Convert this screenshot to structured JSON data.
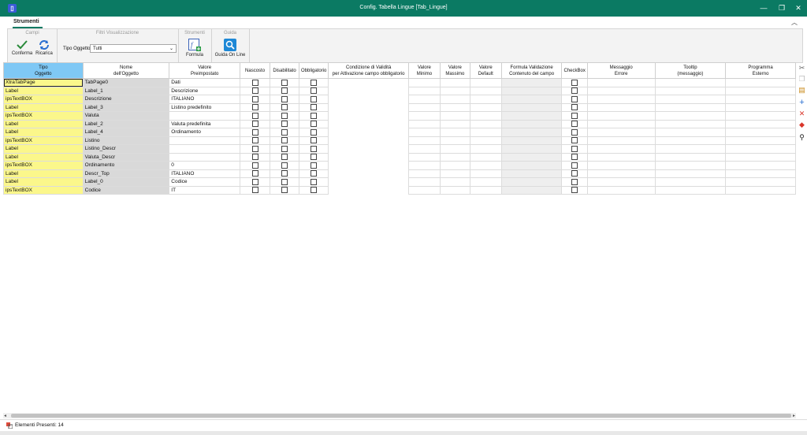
{
  "window": {
    "title": "Config. Tabella Lingue [Tab_Lingue]",
    "minimize": "—",
    "maximize": "❐",
    "close": "✕"
  },
  "ribbon": {
    "tab": "Strumenti",
    "groups": {
      "campi": {
        "title": "Campi",
        "confirm": "Conferma",
        "reload": "Ricarica"
      },
      "filtri": {
        "title": "Filtri Visualizzazione",
        "label": "Tipo Oggetto",
        "value": "Tutti"
      },
      "strumenti": {
        "title": "Strumenti",
        "formula": "Formula"
      },
      "guida": {
        "title": "Guida",
        "online": "Guida On Line"
      }
    }
  },
  "grid": {
    "columns": {
      "tipo": "Tipo\nOggetto",
      "nome": "Nome\ndell'Oggetto",
      "valore": "Valore\nPreimpostato",
      "nascosto": "Nascosto",
      "disabilitato": "Disabilitato",
      "obbligatorio": "Obbligatorio",
      "condizione": "Condizione di Validità\nper Attivazione campo obbligatorio",
      "min": "Valore\nMinimo",
      "max": "Valore\nMassimo",
      "default": "Valore\nDefault",
      "formula": "Formula Validazione\nContenuto del campo",
      "checkbox": "CheckBox",
      "messaggio": "Messaggio\nErrore",
      "tooltip": "Tooltip\n(messaggio)",
      "programma": "Programma\nEsterno"
    },
    "rows": [
      {
        "tipo": "XtraTabPage",
        "nome": "TabPage0",
        "valore": "Dati"
      },
      {
        "tipo": "Label",
        "nome": "Label_1",
        "valore": "Descrizione"
      },
      {
        "tipo": "ipsTextBOX",
        "nome": "Descrizione",
        "valore": "ITALIANO"
      },
      {
        "tipo": "Label",
        "nome": "Label_3",
        "valore": "Listino predefinito"
      },
      {
        "tipo": "ipsTextBOX",
        "nome": "Valuta",
        "valore": ""
      },
      {
        "tipo": "Label",
        "nome": "Label_2",
        "valore": "Valuta predefinita"
      },
      {
        "tipo": "Label",
        "nome": "Label_4",
        "valore": "Ordinamento"
      },
      {
        "tipo": "ipsTextBOX",
        "nome": "Listino",
        "valore": ""
      },
      {
        "tipo": "Label",
        "nome": "Listino_Descr",
        "valore": ""
      },
      {
        "tipo": "Label",
        "nome": "Valuta_Descr",
        "valore": ""
      },
      {
        "tipo": "ipsTextBOX",
        "nome": "Ordinamento",
        "valore": "0"
      },
      {
        "tipo": "Label",
        "nome": "Descr_Top",
        "valore": "ITALIANO"
      },
      {
        "tipo": "Label",
        "nome": "Label_0",
        "valore": "Codice"
      },
      {
        "tipo": "ipsTextBOX",
        "nome": "Codice",
        "valore": "IT"
      }
    ]
  },
  "side_tools": [
    "cut-icon",
    "copy-icon",
    "paste-icon",
    "add-icon",
    "delete-icon",
    "eraser-icon",
    "search-icon"
  ],
  "status": {
    "text": "Elementi Presenti: 14"
  },
  "colors": {
    "titlebar": "#0b7a63",
    "tipo_cell": "#fbf78b",
    "nome_cell": "#d9d9d9",
    "header_selected": "#7fc8f5"
  }
}
